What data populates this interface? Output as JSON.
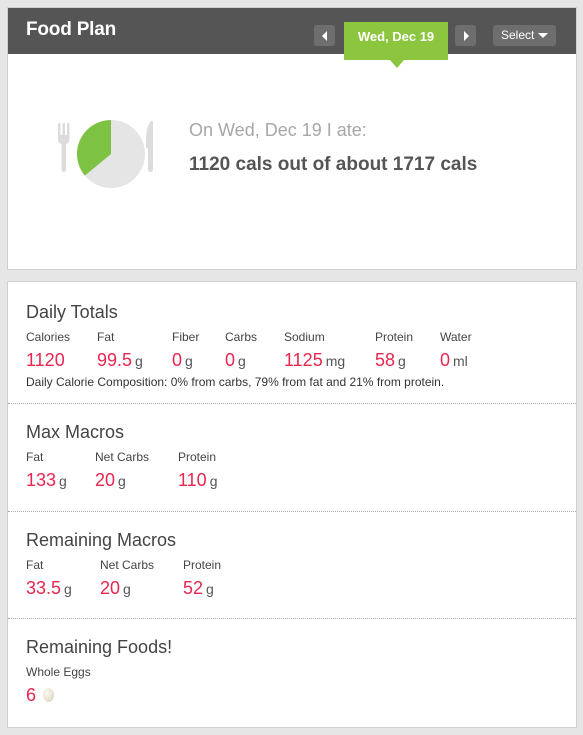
{
  "header": {
    "title": "Food Plan",
    "date": "Wed, Dec 19",
    "select_label": "Select"
  },
  "summary": {
    "ate_line": "On Wed, Dec 19 I ate:",
    "cals_line": "1120 cals out of about 1717 cals",
    "pie_fraction_eaten": 0.652,
    "eaten_color": "#7dc242",
    "remaining_color": "#e5e5e5"
  },
  "daily_totals": {
    "title": "Daily Totals",
    "items": [
      {
        "label": "Calories",
        "value": "1120",
        "unit": ""
      },
      {
        "label": "Fat",
        "value": "99.5",
        "unit": "g"
      },
      {
        "label": "Fiber",
        "value": "0",
        "unit": "g"
      },
      {
        "label": "Carbs",
        "value": "0",
        "unit": "g"
      },
      {
        "label": "Sodium",
        "value": "1125",
        "unit": "mg"
      },
      {
        "label": "Protein",
        "value": "58",
        "unit": "g"
      },
      {
        "label": "Water",
        "value": "0",
        "unit": "ml"
      }
    ],
    "composition": "Daily Calorie Composition: 0% from carbs, 79% from fat and 21% from protein."
  },
  "max_macros": {
    "title": "Max Macros",
    "items": [
      {
        "label": "Fat",
        "value": "133",
        "unit": "g"
      },
      {
        "label": "Net Carbs",
        "value": "20",
        "unit": "g"
      },
      {
        "label": "Protein",
        "value": "110",
        "unit": "g"
      }
    ]
  },
  "remaining_macros": {
    "title": "Remaining Macros",
    "items": [
      {
        "label": "Fat",
        "value": "33.5",
        "unit": "g"
      },
      {
        "label": "Net Carbs",
        "value": "20",
        "unit": "g"
      },
      {
        "label": "Protein",
        "value": "52",
        "unit": "g"
      }
    ]
  },
  "remaining_foods": {
    "title": "Remaining Foods!",
    "items": [
      {
        "label": "Whole Eggs",
        "value": "6",
        "icon": "egg-icon"
      }
    ]
  },
  "colors": {
    "accent_green": "#8cc63f",
    "header_bg": "#555555",
    "value_red": "#e8264f"
  }
}
